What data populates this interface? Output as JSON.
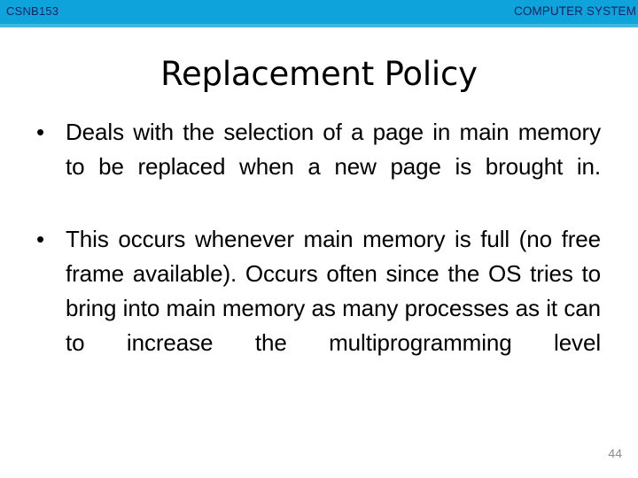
{
  "slide": {
    "header": {
      "course_code": "CSNB153",
      "course_title": "COMPUTER SYSTEM",
      "bar_color": "#0FA3DC",
      "underline_color": "#3EB7E4",
      "text_color": "#12215B"
    },
    "title": "Replacement Policy",
    "bullets": [
      {
        "marker": "•",
        "text": "Deals with the selection of a page in main memory to be replaced when a new page is brought in."
      },
      {
        "marker": "•",
        "text": "This occurs whenever main memory is full (no free frame available). Occurs often since the OS tries to bring into main memory as many processes as it can to increase the multiprogramming level"
      }
    ],
    "page_number": "44",
    "background_color": "#FFFFFF",
    "body_text_color": "#000000",
    "page_number_color": "#8C8C8C"
  }
}
